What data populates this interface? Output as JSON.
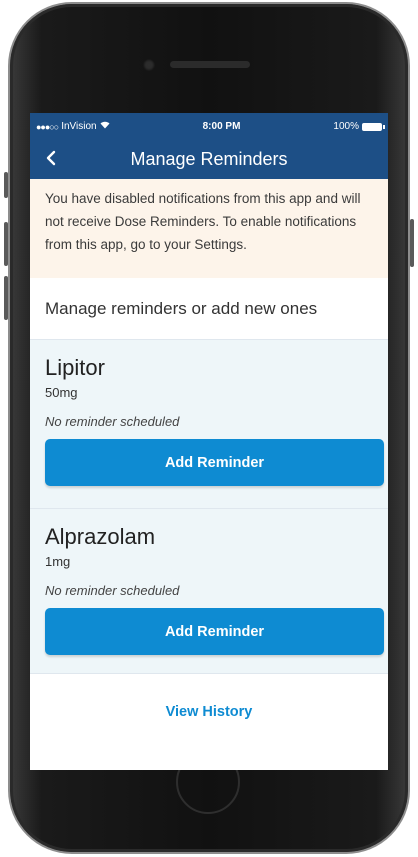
{
  "status_bar": {
    "carrier": "InVision",
    "time": "8:00 PM",
    "battery": "100%"
  },
  "nav": {
    "back_icon": "chevron-left-icon",
    "title": "Manage Reminders"
  },
  "banner": {
    "text": "You have disabled notifications from this app and will not receive Dose Reminders. To enable notifications from this app, go to your Settings."
  },
  "intro": "Manage reminders or add new ones",
  "medications": [
    {
      "name": "Lipitor",
      "dose": "50mg",
      "status": "No reminder scheduled",
      "button_label": "Add Reminder"
    },
    {
      "name": "Alprazolam",
      "dose": "1mg",
      "status": "No reminder scheduled",
      "button_label": "Add Reminder"
    }
  ],
  "history_link": "View History",
  "colors": {
    "header": "#1d4f86",
    "accent": "#0e8bd2",
    "banner_bg": "#fdf4ea",
    "card_bg": "#eef6f9"
  }
}
